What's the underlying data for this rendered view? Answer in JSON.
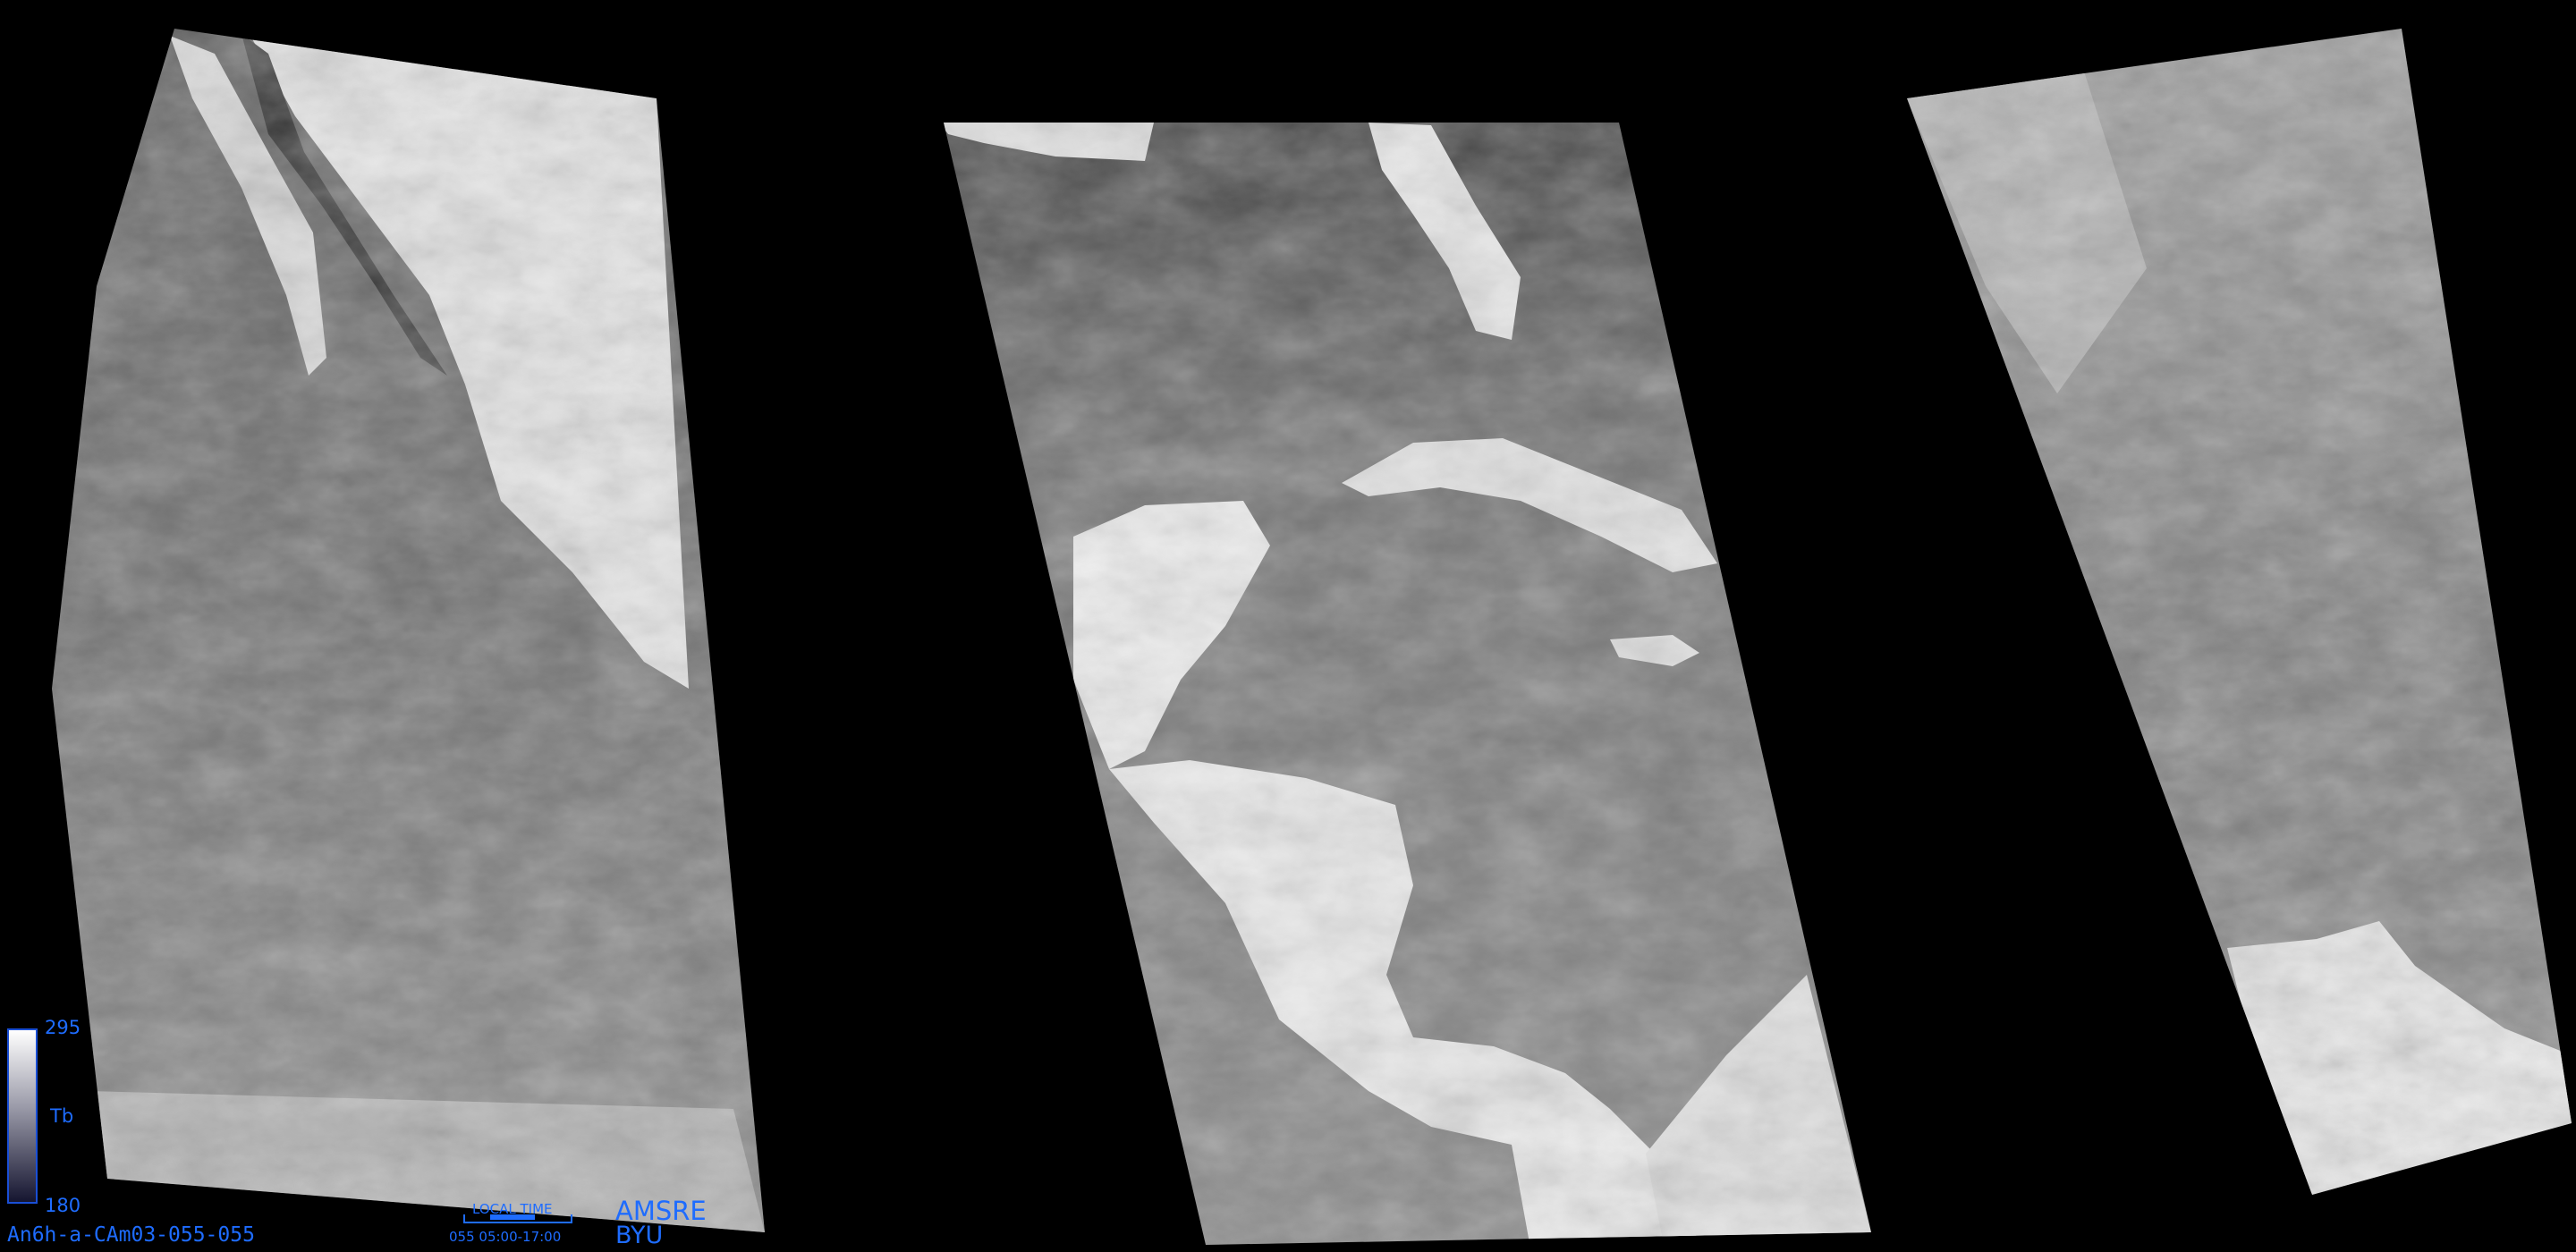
{
  "colorbar": {
    "max": "295",
    "label": "Tb",
    "min": "180"
  },
  "file_id": "An6h-a-CAm03-055-055",
  "local_time": {
    "label": "LOCAL TIME",
    "range": "055 05:00-17:00"
  },
  "sensor": "AMSRE",
  "org": "BYU",
  "colors": {
    "annotation": "#1e6cff",
    "background": "#000000"
  }
}
